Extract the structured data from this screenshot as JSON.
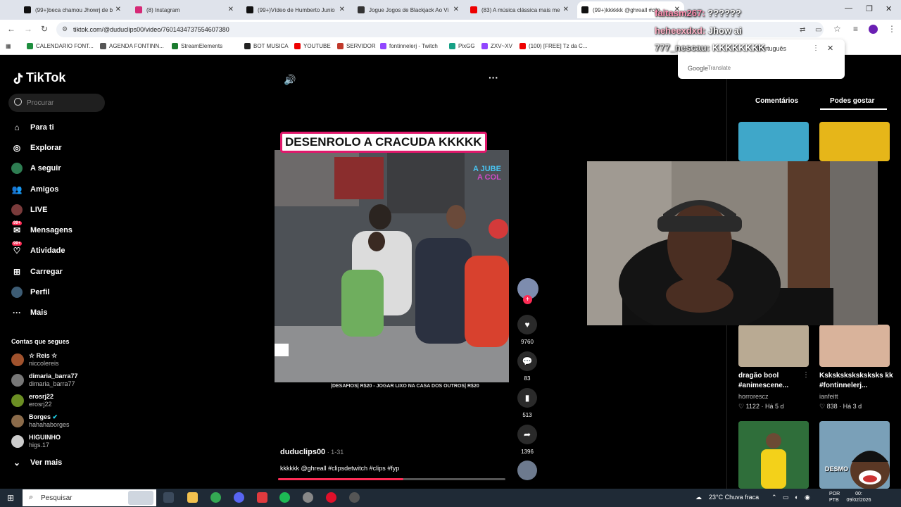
{
  "tabs": [
    {
      "title": "(99+)beca chamou Jhowrj de b",
      "color": "#111"
    },
    {
      "title": "(8) Instagram",
      "color": "#d62976"
    },
    {
      "title": "(99+)Vídeo de Humberto Junio",
      "color": "#111"
    },
    {
      "title": "Jogue Jogos de Blackjack Ao Vi",
      "color": "#333"
    },
    {
      "title": "(83) A música clássica mais me",
      "color": "#e00"
    },
    {
      "title": "(99+)kkkkkk @ghreall #clip",
      "color": "#111"
    }
  ],
  "address": {
    "url": "tiktok.com/@duduclips00/video/7601434737554607380"
  },
  "bookmarks": [
    "CALENDARIO FONT...",
    "AGENDA FONTINN...",
    "StreamElements",
    "BOT MUSICA",
    "YOUTUBE",
    "SERVIDOR",
    "fontinnelerj - Twitch",
    "PixGG",
    "ZXV~XV",
    "(100) [FREE] Tz da C..."
  ],
  "translate": {
    "brand": "Google",
    "label": "Translate",
    "language": "Português"
  },
  "chat": [
    {
      "user": "faitasm267:",
      "text": "??????"
    },
    {
      "user": "heheexdxd:",
      "text": "Jhow ai"
    },
    {
      "user": "777_nescau:",
      "text": "KKKKKKKK"
    }
  ],
  "sidebar": {
    "logo": "TikTok",
    "search_placeholder": "Procurar",
    "items": [
      {
        "label": "Para ti",
        "icon": "home-icon"
      },
      {
        "label": "Explorar",
        "icon": "compass-icon"
      },
      {
        "label": "A seguir",
        "icon": "following-icon"
      },
      {
        "label": "Amigos",
        "icon": "friends-icon"
      },
      {
        "label": "LIVE",
        "icon": "live-icon"
      },
      {
        "label": "Mensagens",
        "icon": "message-icon",
        "badge": "99+"
      },
      {
        "label": "Atividade",
        "icon": "activity-icon",
        "badge": "99+"
      },
      {
        "label": "Carregar",
        "icon": "upload-icon"
      },
      {
        "label": "Perfil",
        "icon": "profile-icon"
      },
      {
        "label": "Mais",
        "icon": "more-icon"
      }
    ],
    "follows_title": "Contas que segues",
    "accounts": [
      {
        "name": "☆ Reis ☆",
        "handle": "niccolereis",
        "color": "#a0522d"
      },
      {
        "name": "dimaria_barra77",
        "handle": "dimaria_barra77",
        "color": "#777"
      },
      {
        "name": "erosrj22",
        "handle": "erosrj22",
        "color": "#6b8e23"
      },
      {
        "name": "Borges",
        "handle": "hahahaborges",
        "color": "#8b6b4a"
      },
      {
        "name": "HIGUINHO",
        "handle": "higs.17",
        "color": "#ccc"
      }
    ],
    "see_more": "Ver mais"
  },
  "video": {
    "title": "DESENROLO A CRACUDA KKKKK",
    "overlay_caption": "|DESAFIOS| R$20 - JOGAR LIXO NA CASA DOS OUTROS| R$20",
    "author": "duduclips00",
    "date": " · 1-31",
    "description": "kkkkkk @ghreall #clipsdetwitch #clips #fyp",
    "progress": 0.55,
    "likes": "9760",
    "comments": "83",
    "saves": "513",
    "shares": "1396"
  },
  "right": {
    "tab_comments": "Comentários",
    "tab_suggest": "Podes gostar",
    "cards": [
      {
        "text": "dragão bool #animescene...",
        "user": "horrorescz",
        "likes": "1122",
        "time": "Há 5 d"
      },
      {
        "text": "Ksksksksksksksks kk #fontinnelerj...",
        "user": "ianfeitt",
        "likes": "838",
        "time": "Há 3 d"
      }
    ],
    "sticker_text": "DESMO"
  },
  "taskbar": {
    "search": "Pesquisar",
    "weather": "23°C  Chuva fraca",
    "lang1": "POR",
    "lang2": "PTB",
    "time": "00:",
    "date": "09/02/2026"
  }
}
